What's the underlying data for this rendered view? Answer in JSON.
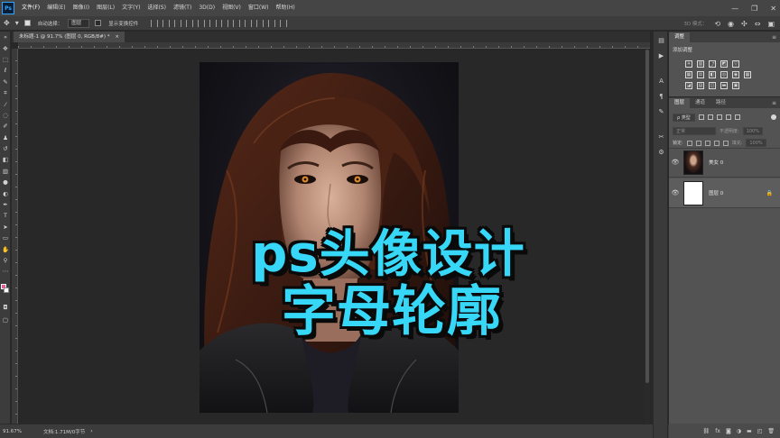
{
  "app": {
    "logo_text": "Ps"
  },
  "menubar": {
    "items": [
      "文件(F)",
      "编辑(E)",
      "图像(I)",
      "图层(L)",
      "文字(Y)",
      "选择(S)",
      "滤镜(T)",
      "3D(D)",
      "视图(V)",
      "窗口(W)",
      "帮助(H)"
    ],
    "window_controls": [
      "—",
      "❐",
      "✕"
    ]
  },
  "options_bar": {
    "auto_select_label": "自动选择：",
    "auto_select_value": "图层",
    "transform_controls_label": "显示变换控件",
    "mode_3d_label": "3D 模式："
  },
  "document": {
    "tab_label": "未标题-1 @ 91.7% (图层 0, RGB/8#) *",
    "tab_close": "×"
  },
  "headline": {
    "line1": "ps头像设计",
    "line2": "字母轮廓"
  },
  "status_bar": {
    "zoom": "91.67%",
    "doc_info": "文档:1.71M/0字节",
    "arrow": "›"
  },
  "adjust_panel": {
    "tab": "调整",
    "subtitle": "添加调整",
    "menu": "≡"
  },
  "layers_panel": {
    "tabs": [
      "图层",
      "通道",
      "路径"
    ],
    "filter_kind": "ρ 类型",
    "blend_mode": "正常",
    "opacity_label": "不透明度:",
    "opacity_value": "100%",
    "lock_label": "锁定:",
    "fill_label": "填充:",
    "fill_value": "100%",
    "layers": [
      {
        "name": "美女 0",
        "visible": true,
        "thumb": "photo",
        "locked": false
      },
      {
        "name": "图层 0",
        "visible": true,
        "thumb": "white",
        "locked": true
      }
    ],
    "footer_icons": [
      "link-icon",
      "fx-icon",
      "mask-icon",
      "adjustment-icon",
      "folder-icon",
      "new-layer-icon",
      "trash-icon"
    ]
  },
  "colors": {
    "foreground": "#e85a9d",
    "background": "#ffffff",
    "headline_fill": "#37d7f7",
    "headline_outline": "#0a0a0a"
  }
}
